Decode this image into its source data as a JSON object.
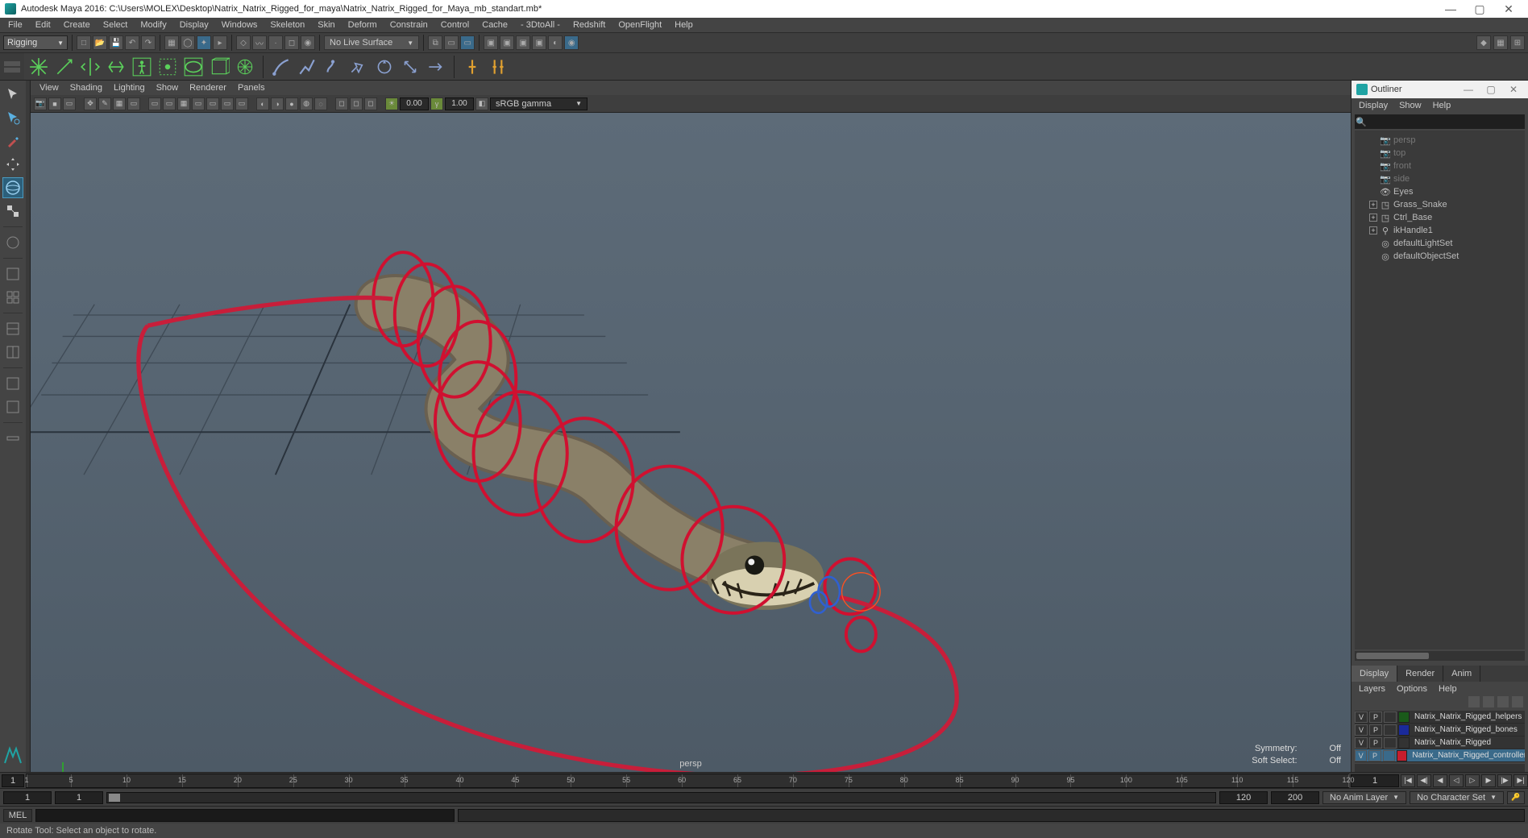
{
  "title": "Autodesk Maya 2016: C:\\Users\\MOLEX\\Desktop\\Natrix_Natrix_Rigged_for_maya\\Natrix_Natrix_Rigged_for_Maya_mb_standart.mb*",
  "main_menu": [
    "File",
    "Edit",
    "Create",
    "Select",
    "Modify",
    "Display",
    "Windows",
    "Skeleton",
    "Skin",
    "Deform",
    "Constrain",
    "Control",
    "Cache",
    "- 3DtoAll -",
    "Redshift",
    "OpenFlight",
    "Help"
  ],
  "mode": "Rigging",
  "live_surface": "No Live Surface",
  "viewport_menu": [
    "View",
    "Shading",
    "Lighting",
    "Show",
    "Renderer",
    "Panels"
  ],
  "vp_num_a": "0.00",
  "vp_num_b": "1.00",
  "vp_colorspace": "sRGB gamma",
  "vp_camera": "persp",
  "vp_symmetry_label": "Symmetry:",
  "vp_symmetry_val": "Off",
  "vp_softsel_label": "Soft Select:",
  "vp_softsel_val": "Off",
  "outliner": {
    "title": "Outliner",
    "menu": [
      "Display",
      "Show",
      "Help"
    ],
    "items": [
      {
        "label": "persp",
        "dim": true,
        "icon": "camera",
        "exp": false
      },
      {
        "label": "top",
        "dim": true,
        "icon": "camera",
        "exp": false
      },
      {
        "label": "front",
        "dim": true,
        "icon": "camera",
        "exp": false
      },
      {
        "label": "side",
        "dim": true,
        "icon": "camera",
        "exp": false
      },
      {
        "label": "Eyes",
        "dim": false,
        "icon": "eye",
        "exp": false
      },
      {
        "label": "Grass_Snake",
        "dim": false,
        "icon": "group",
        "exp": true
      },
      {
        "label": "Ctrl_Base",
        "dim": false,
        "icon": "group",
        "exp": true
      },
      {
        "label": "ikHandle1",
        "dim": false,
        "icon": "ik",
        "exp": true
      },
      {
        "label": "defaultLightSet",
        "dim": false,
        "icon": "set",
        "exp": false
      },
      {
        "label": "defaultObjectSet",
        "dim": false,
        "icon": "set",
        "exp": false
      }
    ]
  },
  "layer_panel": {
    "tabs": [
      "Display",
      "Render",
      "Anim"
    ],
    "active_tab": "Display",
    "menu": [
      "Layers",
      "Options",
      "Help"
    ],
    "rows": [
      {
        "v": "V",
        "p": "P",
        "color": "#1a5a1a",
        "name": "Natrix_Natrix_Rigged_helpers",
        "sel": false
      },
      {
        "v": "V",
        "p": "P",
        "color": "#1a2a9a",
        "name": "Natrix_Natrix_Rigged_bones",
        "sel": false
      },
      {
        "v": "V",
        "p": "P",
        "color": "#333333",
        "name": "Natrix_Natrix_Rigged",
        "sel": false
      },
      {
        "v": "V",
        "p": "P",
        "color": "#c81e2d",
        "name": "Natrix_Natrix_Rigged_controllers",
        "sel": true
      }
    ]
  },
  "timeline": {
    "current": "1",
    "ticks": [
      1,
      5,
      10,
      15,
      20,
      25,
      30,
      35,
      40,
      45,
      50,
      55,
      60,
      65,
      70,
      75,
      80,
      85,
      90,
      95,
      100,
      105,
      110,
      115,
      120
    ],
    "end_current": "1"
  },
  "range": {
    "start_outer": "1",
    "start_inner": "1",
    "end_inner": "120",
    "end_outer": "200",
    "anim_layer": "No Anim Layer",
    "char_set": "No Character Set"
  },
  "cmd_label": "MEL",
  "status_text": "Rotate Tool: Select an object to rotate."
}
